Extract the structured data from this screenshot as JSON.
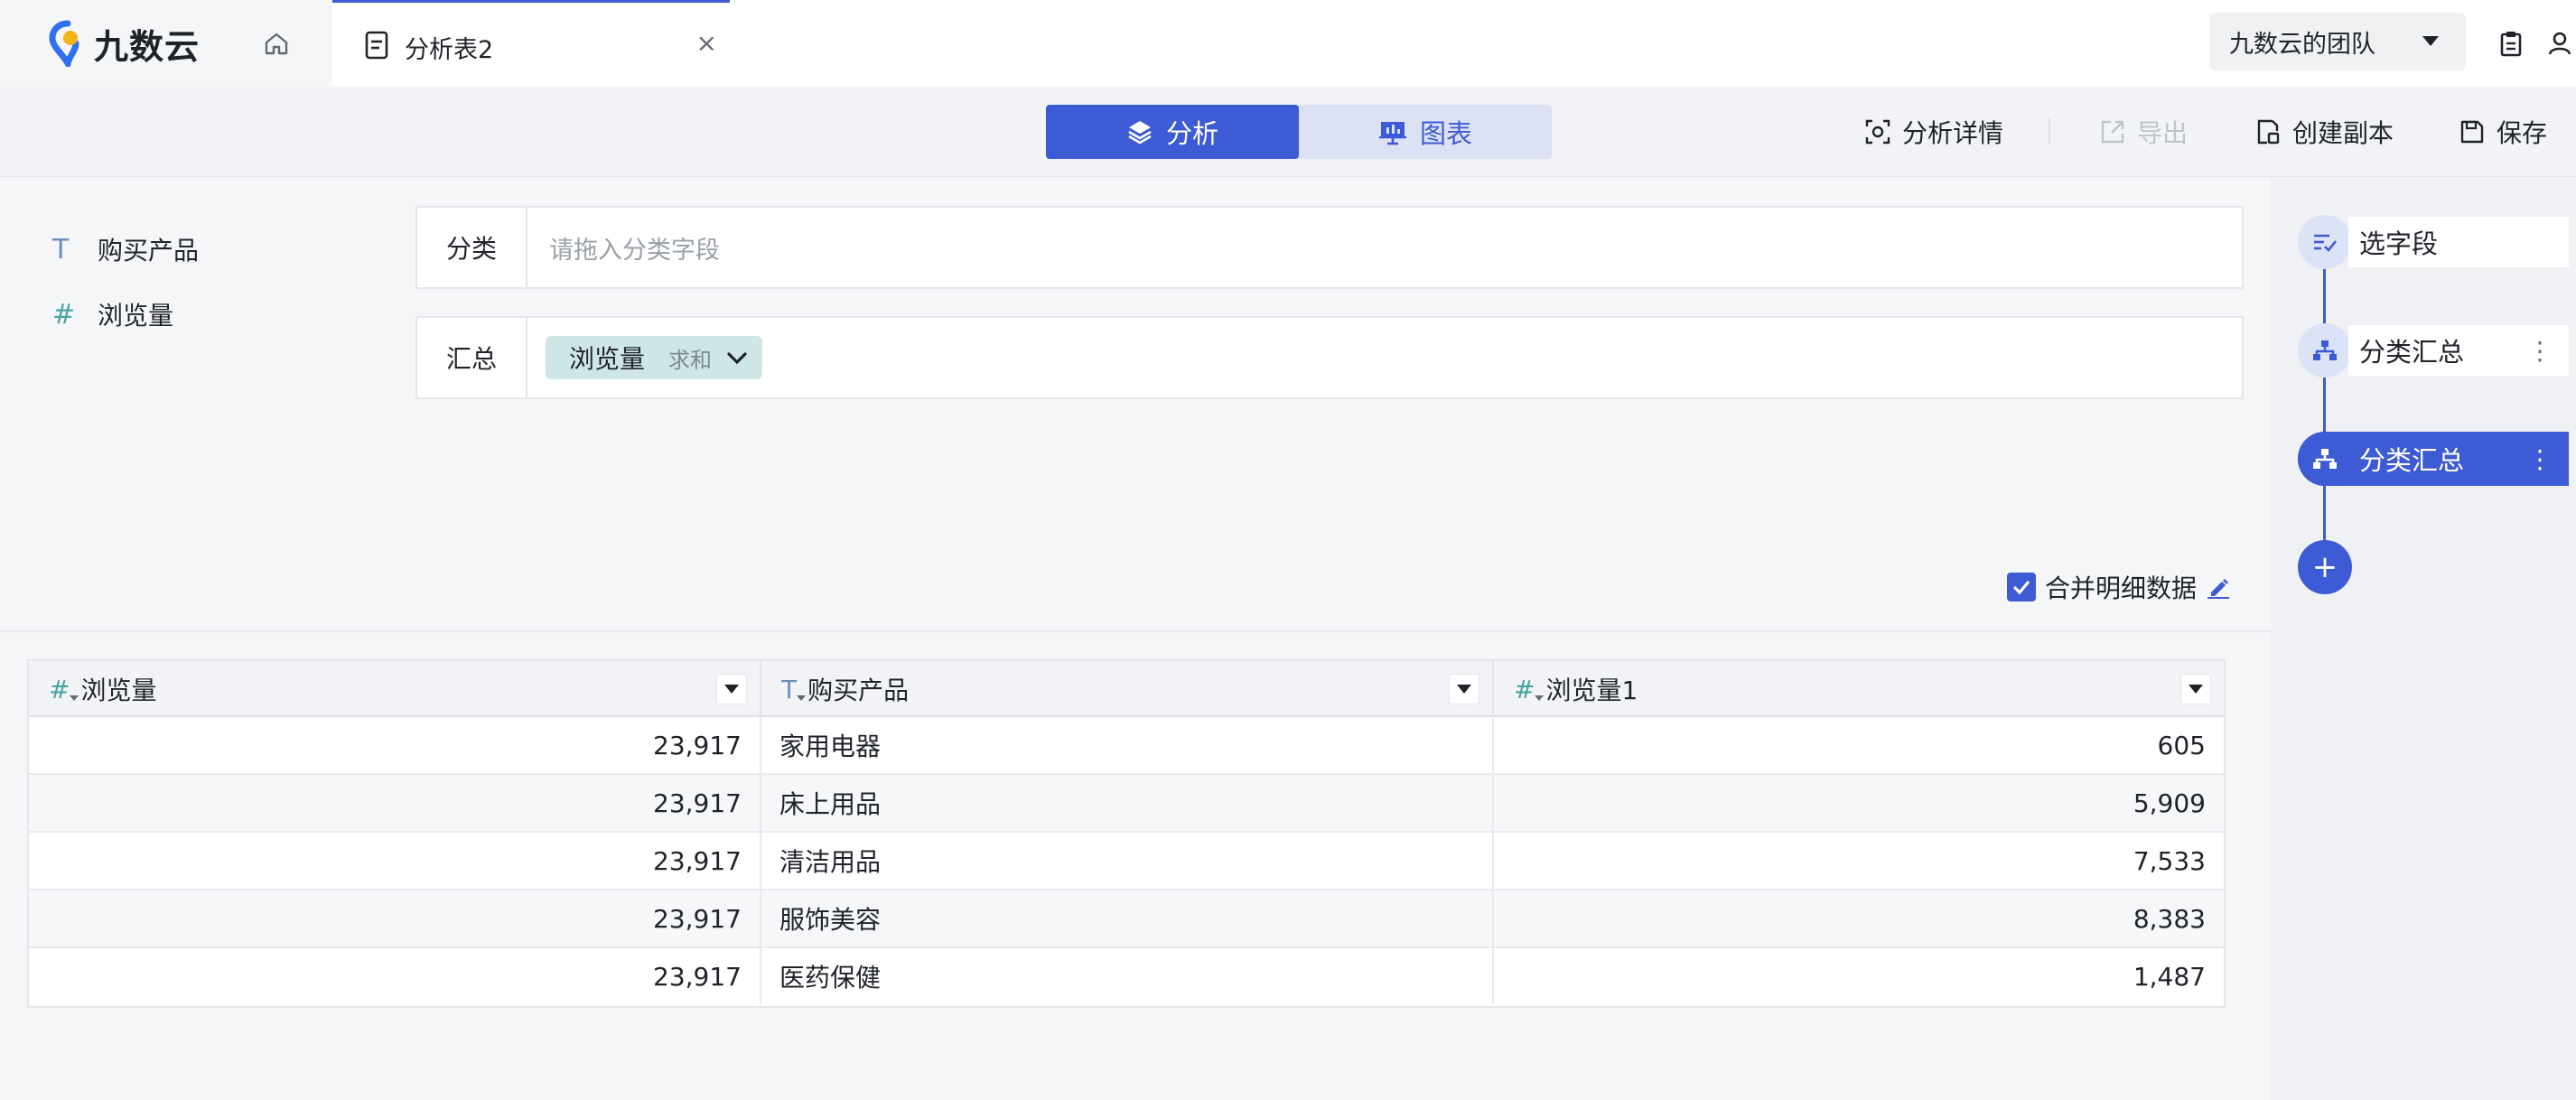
{
  "app": {
    "brand": "九数云",
    "tab_title": "分析表2",
    "tab_close": "×",
    "team": "九数云的团队"
  },
  "toolbar": {
    "segments": [
      {
        "label": "分析",
        "active": true,
        "icon": "layers-icon"
      },
      {
        "label": "图表",
        "active": false,
        "icon": "presentation-chart-icon"
      }
    ],
    "actions": [
      {
        "label": "分析详情",
        "icon": "scan-detail-icon",
        "disabled": false
      },
      {
        "label": "导出",
        "icon": "export-icon",
        "disabled": true
      },
      {
        "label": "创建副本",
        "icon": "copy-file-icon",
        "disabled": false
      },
      {
        "label": "保存",
        "icon": "save-icon",
        "disabled": false
      }
    ]
  },
  "fields": [
    {
      "type_glyph": "T",
      "label": "购买产品"
    },
    {
      "type_glyph": "#",
      "label": "浏览量"
    }
  ],
  "dropzones": {
    "category": {
      "label": "分类",
      "placeholder": "请拖入分类字段"
    },
    "summary": {
      "label": "汇总",
      "pill_field": "浏览量",
      "pill_agg": "求和"
    }
  },
  "merge_detail": {
    "label": "合并明细数据",
    "checked": true
  },
  "table": {
    "columns": [
      {
        "type_glyph": "#",
        "label": "浏览量"
      },
      {
        "type_glyph": "T",
        "label": "购买产品"
      },
      {
        "type_glyph": "#",
        "label": "浏览量1"
      }
    ],
    "rows": [
      [
        "23,917",
        "家用电器",
        "605"
      ],
      [
        "23,917",
        "床上用品",
        "5,909"
      ],
      [
        "23,917",
        "清洁用品",
        "7,533"
      ],
      [
        "23,917",
        "服饰美容",
        "8,383"
      ],
      [
        "23,917",
        "医药保健",
        "1,487"
      ]
    ]
  },
  "steps": [
    {
      "label": "选字段",
      "icon": "select-field-icon",
      "active": false,
      "more": ""
    },
    {
      "label": "分类汇总",
      "icon": "hierarchy-icon",
      "active": false,
      "more": "⋮"
    },
    {
      "label": "分类汇总",
      "icon": "hierarchy-icon",
      "active": true,
      "more": "⋮"
    }
  ],
  "add_step": "+",
  "colors": {
    "accent": "#3d5bd4",
    "pill_bg": "#cfe6e6",
    "numeric_field": "#4aa5a0"
  }
}
